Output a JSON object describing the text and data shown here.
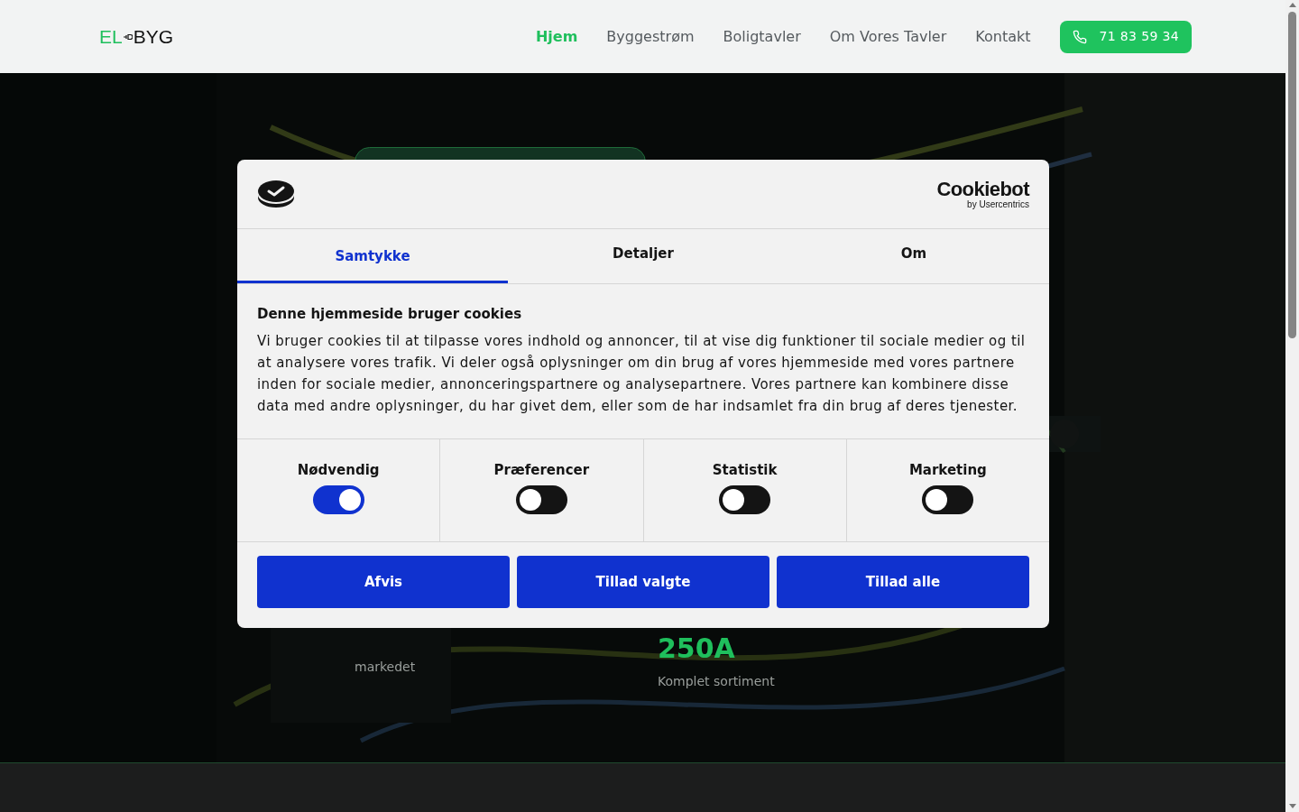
{
  "header": {
    "logo": {
      "left": "EL",
      "right": "BYG"
    },
    "nav": [
      {
        "label": "Hjem",
        "selected": true
      },
      {
        "label": "Byggestrøm",
        "selected": false
      },
      {
        "label": "Boligtavler",
        "selected": false
      },
      {
        "label": "Om Vores Tavler",
        "selected": false
      },
      {
        "label": "Kontakt",
        "selected": false
      }
    ],
    "phone_button": "71 83 59 34"
  },
  "hero": {
    "stats": [
      {
        "label": "markedet"
      },
      {
        "value": "250A",
        "label": "Komplet sortiment"
      }
    ]
  },
  "cookie_dialog": {
    "brand": {
      "name": "Cookiebot",
      "by": "by Usercentrics"
    },
    "tabs": [
      {
        "label": "Samtykke",
        "selected": true
      },
      {
        "label": "Detaljer",
        "selected": false
      },
      {
        "label": "Om",
        "selected": false
      }
    ],
    "heading": "Denne hjemmeside bruger cookies",
    "text": "Vi bruger cookies til at tilpasse vores indhold og annoncer, til at vise dig funktioner til sociale medier og til at analysere vores trafik. Vi deler også oplysninger om din brug af vores hjemmeside med vores partnere inden for sociale medier, annonceringspartnere og analysepartnere. Vores partnere kan kombinere disse data med andre oplysninger, du har givet dem, eller som de har indsamlet fra din brug af deres tjenester.",
    "toggles": [
      {
        "label": "Nødvendig",
        "on": true
      },
      {
        "label": "Præferencer",
        "on": false
      },
      {
        "label": "Statistik",
        "on": false
      },
      {
        "label": "Marketing",
        "on": false
      }
    ],
    "buttons": [
      "Afvis",
      "Tillad valgte",
      "Tillad alle"
    ]
  }
}
